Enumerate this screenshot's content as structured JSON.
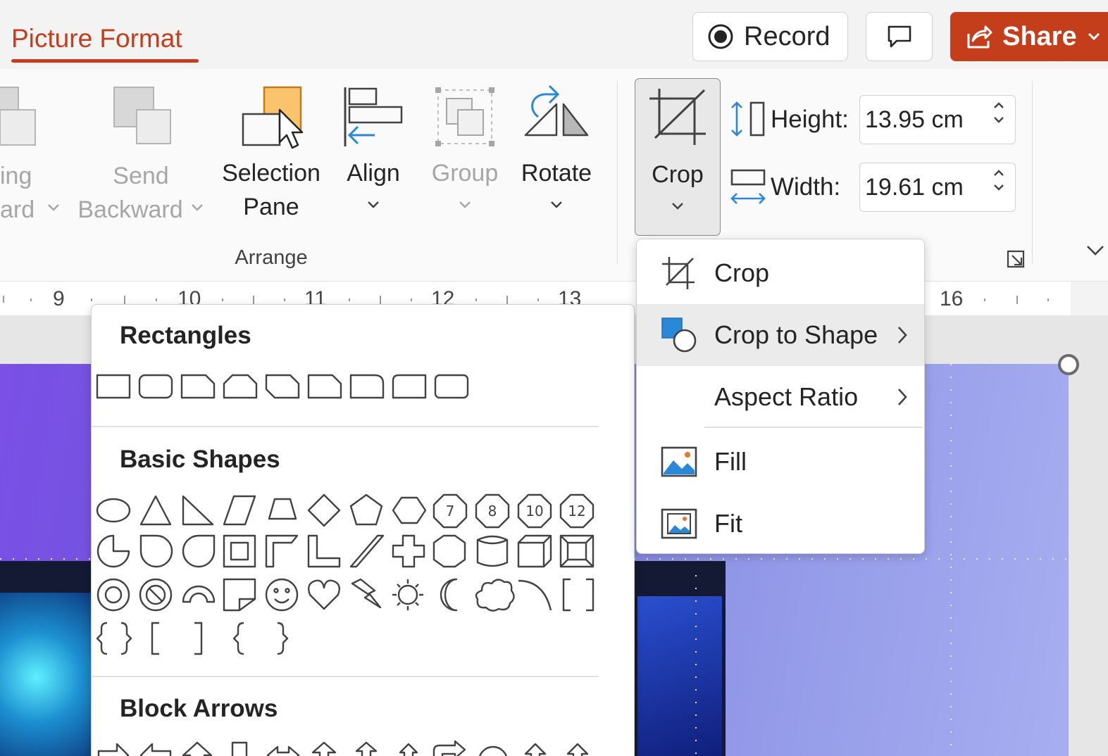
{
  "titlebar": {
    "active_tab": "Picture Format",
    "record_label": "Record",
    "share_label": "Share"
  },
  "ribbon": {
    "bring_forward_label_1": "ing",
    "bring_forward_label_2": "ard",
    "send_backward_label_1": "Send",
    "send_backward_label_2": "Backward",
    "selection_pane_label_1": "Selection",
    "selection_pane_label_2": "Pane",
    "align_label": "Align",
    "group_label": "Group",
    "rotate_label": "Rotate",
    "arrange_group_label": "Arrange",
    "crop_label": "Crop",
    "height_label": "Height:",
    "height_value": "13.95 cm",
    "width_label": "Width:",
    "width_value": "19.61 cm"
  },
  "ruler": {
    "numbers": [
      "9",
      "10",
      "11",
      "12",
      "13",
      "16"
    ]
  },
  "shape_gallery": {
    "sections": [
      "Rectangles",
      "Basic Shapes",
      "Block Arrows"
    ],
    "number_shapes": [
      "7",
      "8",
      "10",
      "12"
    ]
  },
  "crop_menu": {
    "items": [
      {
        "label": "Crop",
        "icon": "crop-icon"
      },
      {
        "label": "Crop to Shape",
        "icon": "crop-to-shape-icon",
        "submenu": true
      },
      {
        "label": "Aspect Ratio",
        "icon": "",
        "submenu": true
      },
      {
        "label": "Fill",
        "icon": "fill-icon"
      },
      {
        "label": "Fit",
        "icon": "fit-icon"
      }
    ]
  },
  "colors": {
    "accent": "#c43e1c",
    "icon_blue": "#2b88d8",
    "selection_pane_orange": "#f9c46b"
  }
}
